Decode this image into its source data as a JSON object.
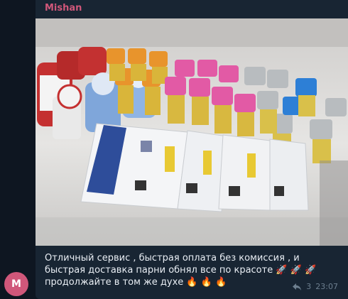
{
  "message": {
    "sender": "Mishan",
    "avatar_letter": "M",
    "text": "Отличный сервис , быстрая оплата без комиссия , и быстрая доставка парни обнял все по красоте 🚀 🚀 🚀 продолжайте в том же духе 🔥 🔥 🔥",
    "replies_count": "3",
    "time": "23:07"
  },
  "colors": {
    "background": "#0e1621",
    "bubble": "#182533",
    "sender": "#d0577a",
    "avatar": "#d0577a"
  },
  "icons": {
    "avatar": "avatar-circle",
    "reply": "reply-arrow-icon"
  }
}
